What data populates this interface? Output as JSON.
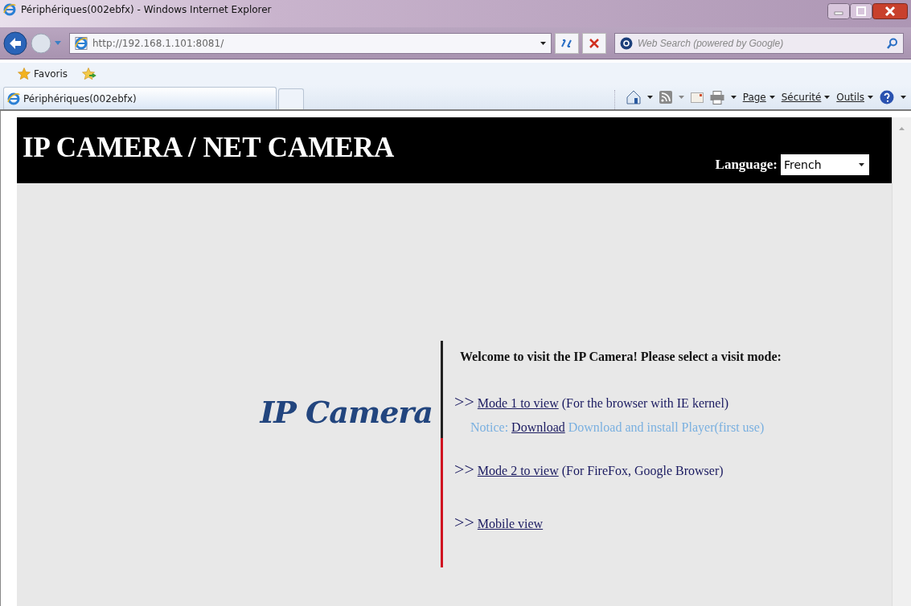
{
  "window": {
    "title": "Périphériques(002ebfx) - Windows Internet Explorer"
  },
  "address_bar": {
    "url": "http://192.168.1.101:8081/"
  },
  "search": {
    "placeholder": "Web Search (powered by Google)"
  },
  "favorites_bar": {
    "label": "Favoris"
  },
  "tabs": [
    {
      "label": "Périphériques(002ebfx)",
      "selected": true
    }
  ],
  "command_bar": [
    "Page",
    "Sécurité",
    "Outils"
  ],
  "page": {
    "banner_title": "IP CAMERA / NET CAMERA",
    "language_label": "Language:",
    "language_value": "French",
    "logo": "IP Camera",
    "welcome": "Welcome to visit the IP Camera! Please select a visit mode:",
    "modes": [
      {
        "marker": ">>",
        "link": "Mode 1 to view",
        "note": "(For the browser with IE kernel)",
        "notice": {
          "label": "Notice:",
          "link": "Download",
          "text": "Download and install Player(first use)"
        }
      },
      {
        "marker": ">>",
        "link": "Mode 2 to view",
        "note": "(For FireFox, Google Browser)"
      },
      {
        "marker": ">>",
        "link": "Mobile view"
      }
    ]
  }
}
